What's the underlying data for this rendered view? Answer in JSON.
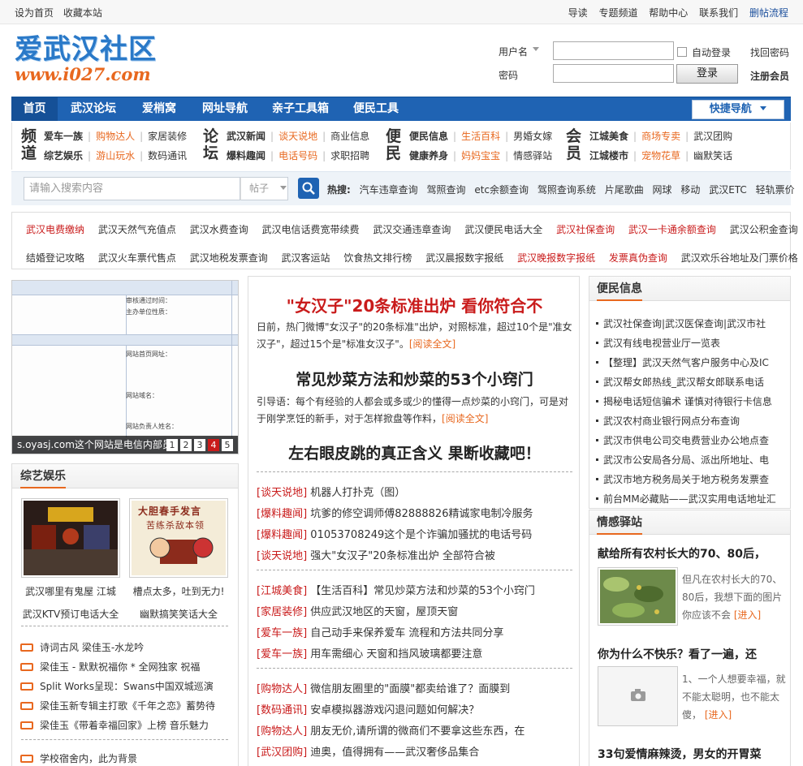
{
  "topbar": {
    "left": [
      "设为首页",
      "收藏本站"
    ],
    "right": [
      "导读",
      "专题频道",
      "帮助中心",
      "联系我们",
      "删帖流程"
    ]
  },
  "logo": {
    "cn": "爱武汉社区",
    "url": "www.i027.com"
  },
  "login": {
    "user_label": "用户名",
    "pass_label": "密码",
    "auto_login": "自动登录",
    "forgot": "找回密码",
    "button": "登录",
    "register": "注册会员"
  },
  "nav": {
    "items": [
      "首页",
      "武汉论坛",
      "爱梢窝",
      "网址导航",
      "亲子工具箱",
      "便民工具"
    ],
    "quick": "快捷导航"
  },
  "channels": {
    "g1": {
      "title": "频道",
      "r1": [
        "爱车一族",
        "购物达人",
        "家居装修"
      ],
      "r2": [
        "综艺娱乐",
        "游山玩水",
        "数码通讯"
      ]
    },
    "g2": {
      "title": "论坛",
      "r1": [
        "武汉新闻",
        "谈天说地",
        "商业信息"
      ],
      "r2": [
        "爆料趣闻",
        "电话号码",
        "求职招聘"
      ]
    },
    "g3": {
      "title": "便民",
      "r1": [
        "便民信息",
        "生活百科",
        "男婚女嫁"
      ],
      "r2": [
        "健康养身",
        "妈妈宝宝",
        "情感驿站"
      ]
    },
    "g4": {
      "title": "会员",
      "r1": [
        "江城美食",
        "商场专卖",
        "武汉团购"
      ],
      "r2": [
        "江城楼市",
        "宠物花草",
        "幽默笑话"
      ]
    }
  },
  "search": {
    "placeholder": "请输入搜索内容",
    "type": "帖子",
    "hot_label": "热搜:",
    "hot": [
      "汽车违章查询",
      "驾照查询",
      "etc余额查询",
      "驾照查询系统",
      "片尾歌曲",
      "网球",
      "移动",
      "武汉ETC",
      "轻轨票价"
    ]
  },
  "links": {
    "row1": [
      "武汉电费缴纳",
      "武汉天然气充值点",
      "武汉水费查询",
      "武汉电信话费宽带续费",
      "武汉交通违章查询",
      "武汉便民电话大全",
      "武汉社保查询",
      "武汉一卡通余额查询",
      "武汉公积金查询"
    ],
    "row2": [
      "结婚登记攻略",
      "武汉火车票代售点",
      "武汉地税发票查询",
      "武汉客运站",
      "饮食热文排行榜",
      "武汉晨报数字报纸",
      "武汉晚报数字报纸",
      "发票真伪查询",
      "武汉欢乐谷地址及门票价格"
    ]
  },
  "slide": {
    "caption": "s.oyasj.com这个网站是电信内部员",
    "pages": [
      "1",
      "2",
      "3",
      "4",
      "5"
    ],
    "active": "4",
    "form_labels": [
      "审核通过时间：",
      "主办单位性质：",
      "网站首页网址：",
      "网站域名：",
      "网站负责人姓名："
    ]
  },
  "zongyi": {
    "title": "综艺娱乐",
    "thumb1_cap": "武汉哪里有鬼屋 江城",
    "thumb2_cap": "槽点太多，吐到无力!",
    "thumb2_text": [
      "大胆春手发言",
      "苦练杀敌本领"
    ],
    "extra1": "武汉KTV预订电话大全",
    "extra2": "幽默搞笑笑话大全",
    "list": [
      "诗词古风 梁佳玉-水龙吟",
      "梁佳玉 - 默默祝福你 * 全网独家 祝福",
      "Split Works呈现：Swans中国双城巡演",
      "梁佳玉新专辑主打歌《千年之恋》蓄势待",
      "梁佳玉《带着幸福回家》上榜 音乐魅力"
    ],
    "list_last": "学校宿舍内，此为背景"
  },
  "middle": {
    "headline1": "\"女汉子\"20条标准出炉 看你符合不",
    "para1": "日前，热门微博\"女汉子\"的20条标准\"出炉，对照标准，超过10个是\"准女汉子\"，超过15个是\"标准女汉子\"。",
    "read": "[阅读全文]",
    "headline2": "常见炒菜方法和炒菜的53个小窍门",
    "para2": "引导语：每个有经验的人都会或多或少的懂得一点炒菜的小窍门，可是对于刚学烹饪的新手，对于怎样掀盘等作料，",
    "headline3": "左右眼皮跳的真正含义 果断收藏吧！",
    "list1": [
      {
        "tag": "[谈天说地]",
        "text": "机器人打扑克（图）"
      },
      {
        "tag": "[爆料趣闻]",
        "text": "坑爹的修空调师傅82888826精诚家电制冷服务"
      },
      {
        "tag": "[爆料趣闻]",
        "text": "01053708249这个是个诈骗加骚扰的电话号码"
      },
      {
        "tag": "[谈天说地]",
        "text": "强大\"女汉子\"20条标准出炉 全部符合被"
      }
    ],
    "list2": [
      {
        "tag": "[江城美食]",
        "text": "【生活百科】常见炒菜方法和炒菜的53个小窍门"
      },
      {
        "tag": "[家居装修]",
        "text": "供应武汉地区的天窗，屋顶天窗"
      },
      {
        "tag": "[爱车一族]",
        "text": "自己动手来保养爱车 流程和方法共同分享"
      },
      {
        "tag": "[爱车一族]",
        "text": "用车需细心 天窗和挡风玻璃都要注意"
      }
    ],
    "list3": [
      {
        "tag": "[购物达人]",
        "text": "微信朋友圈里的\"面膜\"都卖给谁了？面膜到"
      },
      {
        "tag": "[数码通讯]",
        "text": "安卓模拟器游戏闪退问题如何解决？"
      },
      {
        "tag": "[购物达人]",
        "text": "朋友无价,请所谓的微商们不要拿这些东西，在"
      },
      {
        "tag": "[武汉团购]",
        "text": "迪奥，值得拥有——武汉奢侈品集合"
      }
    ]
  },
  "bianmin": {
    "title": "便民信息",
    "items": [
      "武汉社保查询|武汉医保查询|武汉市社",
      "武汉有线电视营业厅一览表",
      "【整理】武汉天然气客户服务中心及IC",
      "武汉帮女郎热线_武汉帮女郎联系电话",
      "揭秘电话短信骗术 谨慎对待银行卡信息",
      "武汉农村商业银行网点分布查询",
      "武汉市供电公司交电费营业办公地点查",
      "武汉市公安局各分局、派出所地址、电",
      "武汉市地方税务局关于地方税务发票查",
      "前台MM必藏贴——武汉实用电话地址汇"
    ]
  },
  "qinggan": {
    "title": "情感驿站",
    "a1_title": "献给所有农村长大的70、80后，",
    "a1_text": "但凡在农村长大的70、80后，我想下面的图片你应该不会",
    "a2_title": "你为什么不快乐？看了一遍，还",
    "a2_text": "1、一个人想要幸福，就不能太聪明，也不能太傻，",
    "a3_title": "33句爱情麻辣烫，男女的开胃菜",
    "enter": "[进入]"
  }
}
